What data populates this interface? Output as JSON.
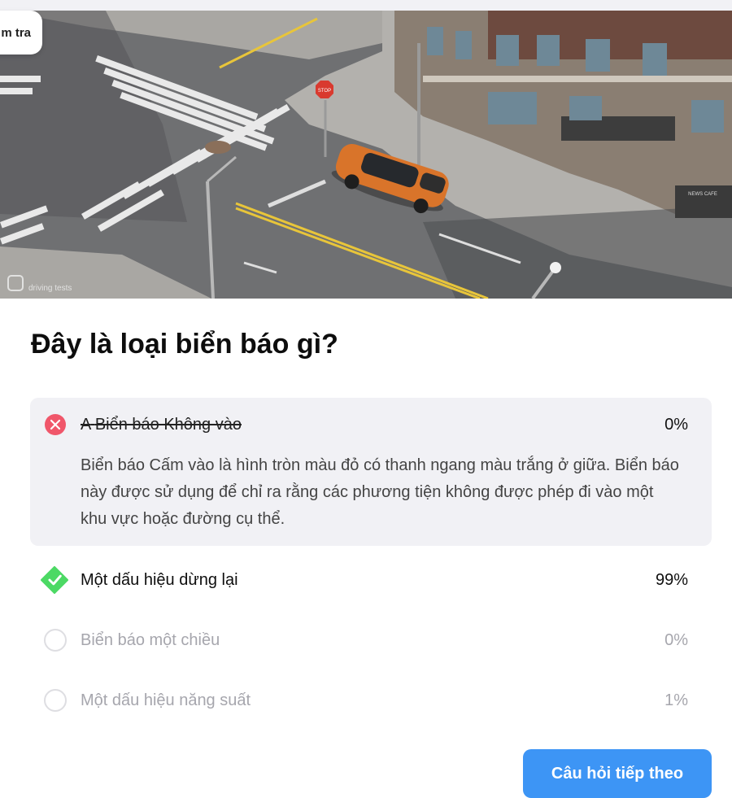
{
  "header": {
    "badge_text": "m tra",
    "watermark": "driving tests"
  },
  "image": {
    "stop_sign_text": "STOP",
    "storefront_text": "NEWS CAFE"
  },
  "quiz": {
    "question": "Đây là loại biển báo gì?",
    "options": [
      {
        "prefix": "A",
        "label": "Biển báo Không vào",
        "percent": "0%",
        "state": "wrong",
        "explanation": "Biển báo Cấm vào là hình tròn màu đỏ có thanh ngang màu trắng ở giữa. Biển báo này được sử dụng để chỉ ra rằng các phương tiện không được phép đi vào một khu vực hoặc đường cụ thể."
      },
      {
        "label": "Một dấu hiệu dừng lại",
        "percent": "99%",
        "state": "correct"
      },
      {
        "label": "Biển báo một chiều",
        "percent": "0%",
        "state": "unselected"
      },
      {
        "label": "Một dấu hiệu năng suất",
        "percent": "1%",
        "state": "unselected"
      }
    ],
    "next_button": "Câu hỏi tiếp theo"
  },
  "colors": {
    "wrong": "#f0566a",
    "correct": "#4cd964",
    "accent": "#3d95f5",
    "card_bg": "#f1f1f5"
  }
}
